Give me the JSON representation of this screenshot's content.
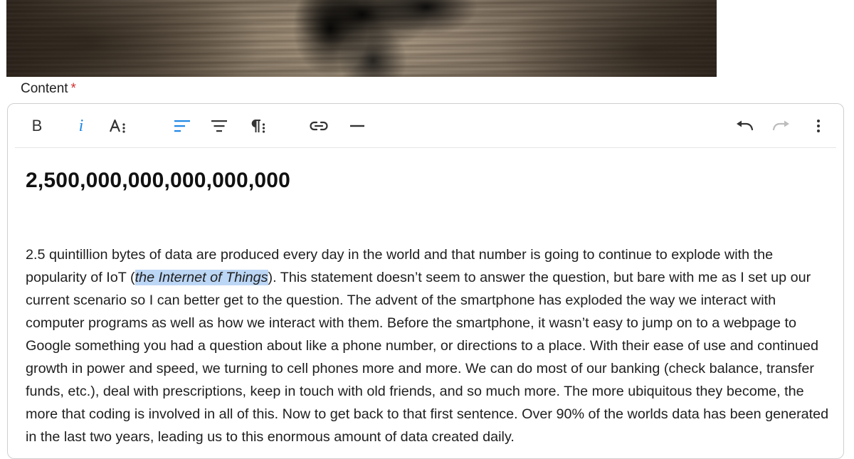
{
  "cover": {
    "image_name": "cover-photo"
  },
  "form": {
    "content_label": "Content",
    "required_mark": "*"
  },
  "toolbar": {
    "bold": "B",
    "italic": "i",
    "icons": [
      "font-size-icon",
      "align-left-icon",
      "align-center-icon",
      "paragraph-icon",
      "link-icon",
      "horizontal-rule-icon",
      "undo-icon",
      "redo-icon",
      "more-vert-icon"
    ],
    "accent_color": "#1e88e5"
  },
  "document": {
    "heading": "2,500,000,000,000,000,000",
    "para_part1": "2.5 quintillion bytes of data are produced every day in the world and that number is going to continue to explode with the popularity of IoT (",
    "para_selected": "the Internet of Things",
    "para_part2": "). This statement doesn’t seem to answer the question, but bare with me as I set up our current scenario so I can better get to the question. The advent of the smartphone has exploded the way we interact with computer programs as well as how we interact with them. Before the smartphone, it wasn’t easy to jump on to a webpage to Google something you had a question about like a phone number, or directions to a place. With their ease of use and continued growth in power and speed, we turning to cell phones more and more. We can do most of our banking (check balance, transfer funds, etc.), deal with prescriptions, keep in touch with old friends, and so much more. The more ubiquitous they become, the more that coding is involved in all of this. Now to get back to that first sentence. Over 90% of the worlds data has been generated in the last two years, leading us to this enormous amount of data created daily.",
    "selection_color": "#bcd6f5"
  }
}
